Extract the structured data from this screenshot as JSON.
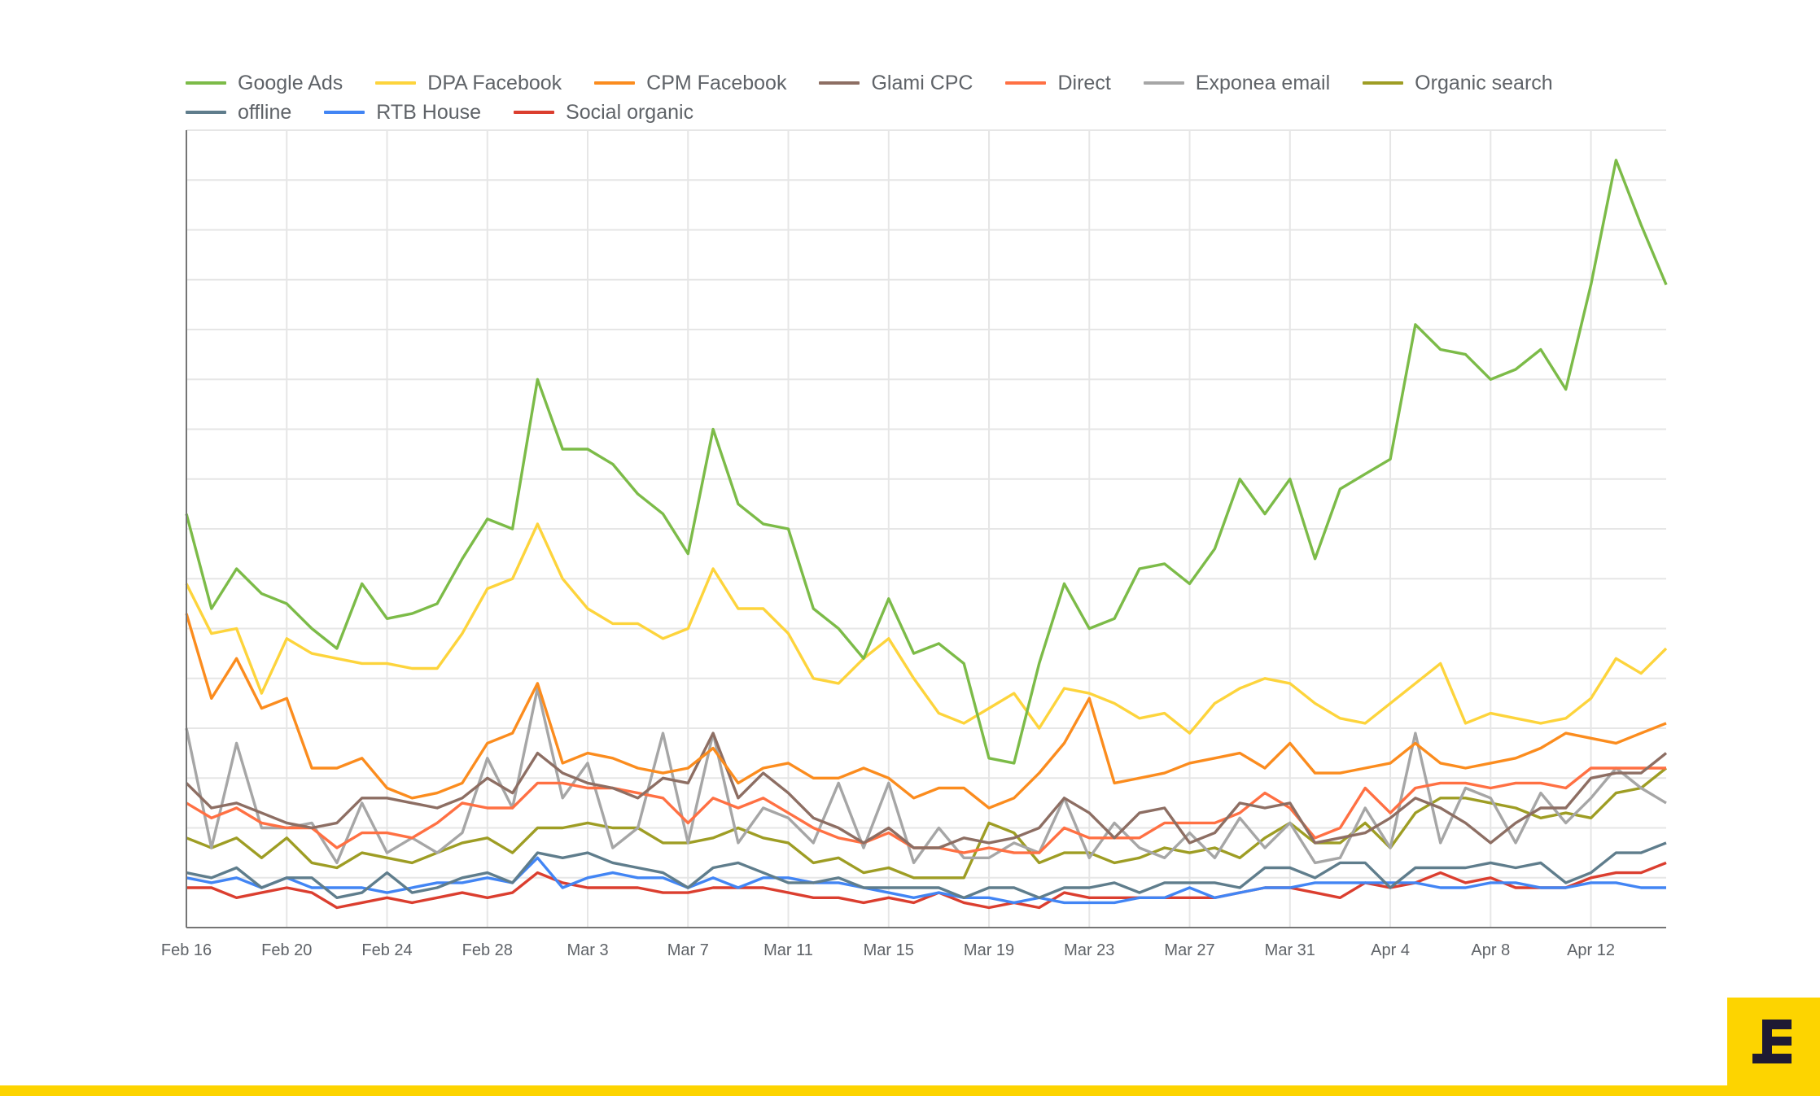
{
  "chart_data": {
    "type": "line",
    "title": "",
    "xlabel": "",
    "ylabel": "",
    "y_axis_labels_shown": false,
    "ylim": [
      0,
      16
    ],
    "y_unit_note": "values estimated in gridline units (no y tick labels shown)",
    "grid": true,
    "legend_position": "top",
    "x_tick_labels": [
      "Feb 16",
      "Feb 20",
      "Feb 24",
      "Feb 28",
      "Mar 3",
      "Mar 7",
      "Mar 11",
      "Mar 15",
      "Mar 19",
      "Mar 23",
      "Mar 27",
      "Mar 31",
      "Apr 4",
      "Apr 8",
      "Apr 12"
    ],
    "x": [
      "Feb 16",
      "Feb 17",
      "Feb 18",
      "Feb 19",
      "Feb 20",
      "Feb 21",
      "Feb 22",
      "Feb 23",
      "Feb 24",
      "Feb 25",
      "Feb 26",
      "Feb 27",
      "Feb 28",
      "Feb 29",
      "Mar 1",
      "Mar 2",
      "Mar 3",
      "Mar 4",
      "Mar 5",
      "Mar 6",
      "Mar 7",
      "Mar 8",
      "Mar 9",
      "Mar 10",
      "Mar 11",
      "Mar 12",
      "Mar 13",
      "Mar 14",
      "Mar 15",
      "Mar 16",
      "Mar 17",
      "Mar 18",
      "Mar 19",
      "Mar 20",
      "Mar 21",
      "Mar 22",
      "Mar 23",
      "Mar 24",
      "Mar 25",
      "Mar 26",
      "Mar 27",
      "Mar 28",
      "Mar 29",
      "Mar 30",
      "Mar 31",
      "Apr 1",
      "Apr 2",
      "Apr 3",
      "Apr 4",
      "Apr 5",
      "Apr 6",
      "Apr 7",
      "Apr 8",
      "Apr 9",
      "Apr 10",
      "Apr 11",
      "Apr 12",
      "Apr 13",
      "Apr 14",
      "Apr 15"
    ],
    "series": [
      {
        "name": "Google Ads",
        "color": "#7cbb48",
        "values": [
          8.3,
          6.4,
          7.2,
          6.7,
          6.5,
          6.0,
          5.6,
          6.9,
          6.2,
          6.3,
          6.5,
          7.4,
          8.2,
          8.0,
          11.0,
          9.6,
          9.6,
          9.3,
          8.7,
          8.3,
          7.5,
          10.0,
          8.5,
          8.1,
          8.0,
          6.4,
          6.0,
          5.4,
          6.6,
          5.5,
          5.7,
          5.3,
          3.4,
          3.3,
          5.3,
          6.9,
          6.0,
          6.2,
          7.2,
          7.3,
          6.9,
          7.6,
          9.0,
          8.3,
          9.0,
          7.4,
          8.8,
          9.1,
          9.4,
          12.1,
          11.6,
          11.5,
          11.0,
          11.2,
          11.6,
          10.8,
          12.9,
          15.4,
          14.1,
          12.9
        ]
      },
      {
        "name": "DPA Facebook",
        "color": "#fdd43c",
        "values": [
          6.9,
          5.9,
          6.0,
          4.7,
          5.8,
          5.5,
          5.4,
          5.3,
          5.3,
          5.2,
          5.2,
          5.9,
          6.8,
          7.0,
          8.1,
          7.0,
          6.4,
          6.1,
          6.1,
          5.8,
          6.0,
          7.2,
          6.4,
          6.4,
          5.9,
          5.0,
          4.9,
          5.4,
          5.8,
          5.0,
          4.3,
          4.1,
          4.4,
          4.7,
          4.0,
          4.8,
          4.7,
          4.5,
          4.2,
          4.3,
          3.9,
          4.5,
          4.8,
          5.0,
          4.9,
          4.5,
          4.2,
          4.1,
          4.5,
          4.9,
          5.3,
          4.1,
          4.3,
          4.2,
          4.1,
          4.2,
          4.6,
          5.4,
          5.1,
          5.6
        ]
      },
      {
        "name": "CPM Facebook",
        "color": "#fb8c1e",
        "values": [
          6.3,
          4.6,
          5.4,
          4.4,
          4.6,
          3.2,
          3.2,
          3.4,
          2.8,
          2.6,
          2.7,
          2.9,
          3.7,
          3.9,
          4.9,
          3.3,
          3.5,
          3.4,
          3.2,
          3.1,
          3.2,
          3.6,
          2.9,
          3.2,
          3.3,
          3.0,
          3.0,
          3.2,
          3.0,
          2.6,
          2.8,
          2.8,
          2.4,
          2.6,
          3.1,
          3.7,
          4.6,
          2.9,
          3.0,
          3.1,
          3.3,
          3.4,
          3.5,
          3.2,
          3.7,
          3.1,
          3.1,
          3.2,
          3.3,
          3.7,
          3.3,
          3.2,
          3.3,
          3.4,
          3.6,
          3.9,
          3.8,
          3.7,
          3.9,
          4.1
        ]
      },
      {
        "name": "Glami CPC",
        "color": "#8d6e63",
        "values": [
          2.9,
          2.4,
          2.5,
          2.3,
          2.1,
          2.0,
          2.1,
          2.6,
          2.6,
          2.5,
          2.4,
          2.6,
          3.0,
          2.7,
          3.5,
          3.1,
          2.9,
          2.8,
          2.6,
          3.0,
          2.9,
          3.9,
          2.6,
          3.1,
          2.7,
          2.2,
          2.0,
          1.7,
          2.0,
          1.6,
          1.6,
          1.8,
          1.7,
          1.8,
          2.0,
          2.6,
          2.3,
          1.8,
          2.3,
          2.4,
          1.7,
          1.9,
          2.5,
          2.4,
          2.5,
          1.7,
          1.8,
          1.9,
          2.2,
          2.6,
          2.4,
          2.1,
          1.7,
          2.1,
          2.4,
          2.4,
          3.0,
          3.1,
          3.1,
          3.5
        ]
      },
      {
        "name": "Direct",
        "color": "#ff7043",
        "values": [
          2.5,
          2.2,
          2.4,
          2.1,
          2.0,
          2.0,
          1.6,
          1.9,
          1.9,
          1.8,
          2.1,
          2.5,
          2.4,
          2.4,
          2.9,
          2.9,
          2.8,
          2.8,
          2.7,
          2.6,
          2.1,
          2.6,
          2.4,
          2.6,
          2.3,
          2.0,
          1.8,
          1.7,
          1.9,
          1.6,
          1.6,
          1.5,
          1.6,
          1.5,
          1.5,
          2.0,
          1.8,
          1.8,
          1.8,
          2.1,
          2.1,
          2.1,
          2.3,
          2.7,
          2.4,
          1.8,
          2.0,
          2.8,
          2.3,
          2.8,
          2.9,
          2.9,
          2.8,
          2.9,
          2.9,
          2.8,
          3.2,
          3.2,
          3.2,
          3.2
        ]
      },
      {
        "name": "Exponea email",
        "color": "#a6a6a6",
        "values": [
          4.0,
          1.6,
          3.7,
          2.0,
          2.0,
          2.1,
          1.3,
          2.5,
          1.5,
          1.8,
          1.5,
          1.9,
          3.4,
          2.4,
          4.8,
          2.6,
          3.3,
          1.6,
          2.0,
          3.9,
          1.7,
          3.9,
          1.7,
          2.4,
          2.2,
          1.7,
          2.9,
          1.6,
          2.9,
          1.3,
          2.0,
          1.4,
          1.4,
          1.7,
          1.5,
          2.6,
          1.4,
          2.1,
          1.6,
          1.4,
          1.9,
          1.4,
          2.2,
          1.6,
          2.1,
          1.3,
          1.4,
          2.4,
          1.6,
          3.9,
          1.7,
          2.8,
          2.6,
          1.7,
          2.7,
          2.1,
          2.6,
          3.2,
          2.8,
          2.5
        ]
      },
      {
        "name": "Organic search",
        "color": "#9e9d24",
        "values": [
          1.8,
          1.6,
          1.8,
          1.4,
          1.8,
          1.3,
          1.2,
          1.5,
          1.4,
          1.3,
          1.5,
          1.7,
          1.8,
          1.5,
          2.0,
          2.0,
          2.1,
          2.0,
          2.0,
          1.7,
          1.7,
          1.8,
          2.0,
          1.8,
          1.7,
          1.3,
          1.4,
          1.1,
          1.2,
          1.0,
          1.0,
          1.0,
          2.1,
          1.9,
          1.3,
          1.5,
          1.5,
          1.3,
          1.4,
          1.6,
          1.5,
          1.6,
          1.4,
          1.8,
          2.1,
          1.7,
          1.7,
          2.1,
          1.6,
          2.3,
          2.6,
          2.6,
          2.5,
          2.4,
          2.2,
          2.3,
          2.2,
          2.7,
          2.8,
          3.2
        ]
      },
      {
        "name": "offline",
        "color": "#5f7d8c",
        "values": [
          1.1,
          1.0,
          1.2,
          0.8,
          1.0,
          1.0,
          0.6,
          0.7,
          1.1,
          0.7,
          0.8,
          1.0,
          1.1,
          0.9,
          1.5,
          1.4,
          1.5,
          1.3,
          1.2,
          1.1,
          0.8,
          1.2,
          1.3,
          1.1,
          0.9,
          0.9,
          1.0,
          0.8,
          0.8,
          0.8,
          0.8,
          0.6,
          0.8,
          0.8,
          0.6,
          0.8,
          0.8,
          0.9,
          0.7,
          0.9,
          0.9,
          0.9,
          0.8,
          1.2,
          1.2,
          1.0,
          1.3,
          1.3,
          0.8,
          1.2,
          1.2,
          1.2,
          1.3,
          1.2,
          1.3,
          0.9,
          1.1,
          1.5,
          1.5,
          1.7
        ]
      },
      {
        "name": "RTB House",
        "color": "#4285f4",
        "values": [
          1.0,
          0.9,
          1.0,
          0.8,
          1.0,
          0.8,
          0.8,
          0.8,
          0.7,
          0.8,
          0.9,
          0.9,
          1.0,
          0.9,
          1.4,
          0.8,
          1.0,
          1.1,
          1.0,
          1.0,
          0.8,
          1.0,
          0.8,
          1.0,
          1.0,
          0.9,
          0.9,
          0.8,
          0.7,
          0.6,
          0.7,
          0.6,
          0.6,
          0.5,
          0.6,
          0.5,
          0.5,
          0.5,
          0.6,
          0.6,
          0.8,
          0.6,
          0.7,
          0.8,
          0.8,
          0.9,
          0.9,
          0.9,
          0.9,
          0.9,
          0.8,
          0.8,
          0.9,
          0.9,
          0.8,
          0.8,
          0.9,
          0.9,
          0.8,
          0.8
        ]
      },
      {
        "name": "Social organic",
        "color": "#db3e2f",
        "values": [
          0.8,
          0.8,
          0.6,
          0.7,
          0.8,
          0.7,
          0.4,
          0.5,
          0.6,
          0.5,
          0.6,
          0.7,
          0.6,
          0.7,
          1.1,
          0.9,
          0.8,
          0.8,
          0.8,
          0.7,
          0.7,
          0.8,
          0.8,
          0.8,
          0.7,
          0.6,
          0.6,
          0.5,
          0.6,
          0.5,
          0.7,
          0.5,
          0.4,
          0.5,
          0.4,
          0.7,
          0.6,
          0.6,
          0.6,
          0.6,
          0.6,
          0.6,
          0.7,
          0.8,
          0.8,
          0.7,
          0.6,
          0.9,
          0.8,
          0.9,
          1.1,
          0.9,
          1.0,
          0.8,
          0.8,
          0.8,
          1.0,
          1.1,
          1.1,
          1.3
        ]
      }
    ]
  },
  "legend_rows": [
    [
      0,
      1,
      2,
      3,
      4,
      5,
      6
    ],
    [
      7,
      8,
      9
    ]
  ],
  "brand": {
    "logo_glyph": "E",
    "accent_color": "#fdd400",
    "logo_color": "#1e1a33"
  }
}
